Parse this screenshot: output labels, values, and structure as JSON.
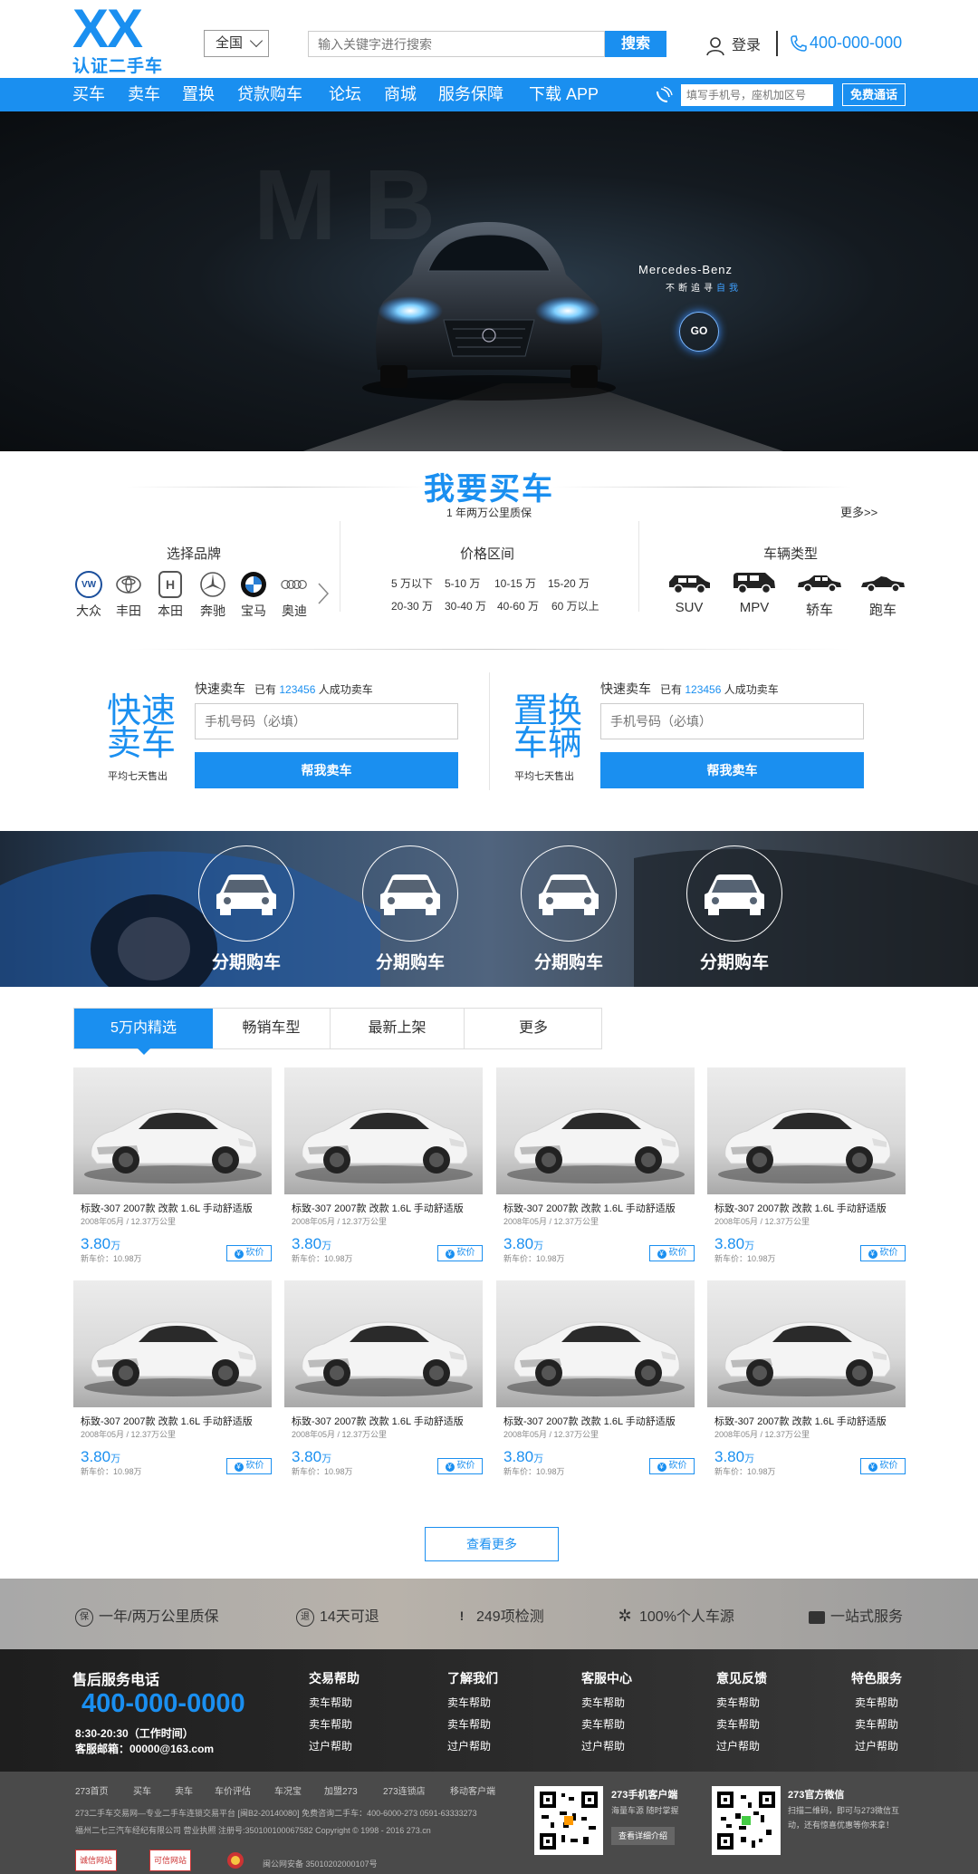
{
  "header": {
    "logo_main": "XX",
    "logo_sub": "认证二手车",
    "region": "全国",
    "search_placeholder": "输入关键字进行搜索",
    "search_button": "搜索",
    "login": "登录",
    "hotline": "400-000-000"
  },
  "nav": {
    "items": [
      "买车",
      "卖车",
      "置换",
      "贷款购车",
      "论坛",
      "商城",
      "服务保障",
      "下载 APP"
    ],
    "phone_placeholder": "填写手机号，座机加区号",
    "call_button": "免费通话"
  },
  "banner": {
    "brand": "Mercedes-Benz",
    "slogan_prefix": "不断追寻",
    "slogan_highlight": "自我",
    "go": "GO"
  },
  "buy": {
    "title": "我要买车",
    "subtitle": "1 年两万公里质保",
    "more": "更多>>",
    "brand_title": "选择品牌",
    "brands": [
      "大众",
      "丰田",
      "本田",
      "奔驰",
      "宝马",
      "奥迪"
    ],
    "price_title": "价格区间",
    "prices": [
      "5 万以下",
      "5-10 万",
      "10-15 万",
      "15-20 万",
      "20-30 万",
      "30-40 万",
      "40-60 万",
      "60 万以上"
    ],
    "type_title": "车辆类型",
    "types": [
      "SUV",
      "MPV",
      "轿车",
      "跑车"
    ]
  },
  "quick": [
    {
      "big1": "快速",
      "big2": "卖车",
      "small": "平均七天售出",
      "label": "快速卖车",
      "count_prefix": "已有",
      "count": "123456",
      "count_suffix": "人成功卖车",
      "placeholder": "手机号码（必填）",
      "button": "帮我卖车"
    },
    {
      "big1": "置换",
      "big2": "车辆",
      "small": "平均七天售出",
      "label": "快速卖车",
      "count_prefix": "已有",
      "count": "123456",
      "count_suffix": "人成功卖车",
      "placeholder": "手机号码（必填）",
      "button": "帮我卖车"
    }
  ],
  "installment": [
    "分期购车",
    "分期购车",
    "分期购车",
    "分期购车"
  ],
  "tabs": [
    "5万内精选",
    "畅销车型",
    "最新上架",
    "更多"
  ],
  "listings": [
    {
      "title": "标致-307 2007款 改款 1.6L 手动舒适版",
      "meta": "2008年05月 / 12.37万公里",
      "price": "3.80",
      "unit": "万",
      "new_price": "新车价：10.98万",
      "bargain": "砍价"
    },
    {
      "title": "标致-307 2007款 改款 1.6L 手动舒适版",
      "meta": "2008年05月 / 12.37万公里",
      "price": "3.80",
      "unit": "万",
      "new_price": "新车价：10.98万",
      "bargain": "砍价"
    },
    {
      "title": "标致-307 2007款 改款 1.6L 手动舒适版",
      "meta": "2008年05月 / 12.37万公里",
      "price": "3.80",
      "unit": "万",
      "new_price": "新车价：10.98万",
      "bargain": "砍价"
    },
    {
      "title": "标致-307 2007款 改款 1.6L 手动舒适版",
      "meta": "2008年05月 / 12.37万公里",
      "price": "3.80",
      "unit": "万",
      "new_price": "新车价：10.98万",
      "bargain": "砍价"
    },
    {
      "title": "标致-307 2007款 改款 1.6L 手动舒适版",
      "meta": "2008年05月 / 12.37万公里",
      "price": "3.80",
      "unit": "万",
      "new_price": "新车价：10.98万",
      "bargain": "砍价"
    },
    {
      "title": "标致-307 2007款 改款 1.6L 手动舒适版",
      "meta": "2008年05月 / 12.37万公里",
      "price": "3.80",
      "unit": "万",
      "new_price": "新车价：10.98万",
      "bargain": "砍价"
    },
    {
      "title": "标致-307 2007款 改款 1.6L 手动舒适版",
      "meta": "2008年05月 / 12.37万公里",
      "price": "3.80",
      "unit": "万",
      "new_price": "新车价：10.98万",
      "bargain": "砍价"
    },
    {
      "title": "标致-307 2007款 改款 1.6L 手动舒适版",
      "meta": "2008年05月 / 12.37万公里",
      "price": "3.80",
      "unit": "万",
      "new_price": "新车价：10.98万",
      "bargain": "砍价"
    }
  ],
  "view_more": "查看更多",
  "guarantees": [
    {
      "icon": "保",
      "text": "一年/两万公里质保"
    },
    {
      "icon": "退",
      "text": "14天可退"
    },
    {
      "icon": "!",
      "text": "249项检测"
    },
    {
      "icon": "✲",
      "text": "100%个人车源"
    },
    {
      "icon": "▬",
      "text": "一站式服务"
    }
  ],
  "footer": {
    "service_title": "售后服务电话",
    "service_phone": "400-000-0000",
    "hours": "8:30-20:30（工作时间）",
    "email": "客服邮箱：00000@163.com",
    "columns": [
      {
        "title": "交易帮助",
        "links": [
          "卖车帮助",
          "卖车帮助",
          "过户帮助"
        ]
      },
      {
        "title": "了解我们",
        "links": [
          "卖车帮助",
          "卖车帮助",
          "过户帮助"
        ]
      },
      {
        "title": "客服中心",
        "links": [
          "卖车帮助",
          "卖车帮助",
          "过户帮助"
        ]
      },
      {
        "title": "意见反馈",
        "links": [
          "卖车帮助",
          "卖车帮助",
          "过户帮助"
        ]
      },
      {
        "title": "特色服务",
        "links": [
          "卖车帮助",
          "卖车帮助",
          "过户帮助"
        ]
      }
    ]
  },
  "bottom": {
    "links": [
      "273首页",
      "买车",
      "卖车",
      "车价评估",
      "车况宝",
      "加盟273",
      "273连锁店",
      "移动客户端"
    ],
    "line1": "273二手车交易网—专业二手车连锁交易平台 [闽B2-20140080]  免费咨询二手车：400-6000-273 0591-63333273",
    "line2": "福州二七三汽车经纪有限公司 营业执照 注册号:350100100067582  Copyright © 1998 - 2016 273.cn",
    "police": "闽公网安备 35010202000107号",
    "badges": [
      "诚信网站",
      "可信网站"
    ],
    "app_title": "273手机客户端",
    "app_desc": "海量车源 随时掌握",
    "app_button": "查看详细介绍",
    "wechat_title": "273官方微信",
    "wechat_desc1": "扫描二维码，即可与273微信互",
    "wechat_desc2": "动，还有惊喜优惠等你来拿！"
  }
}
